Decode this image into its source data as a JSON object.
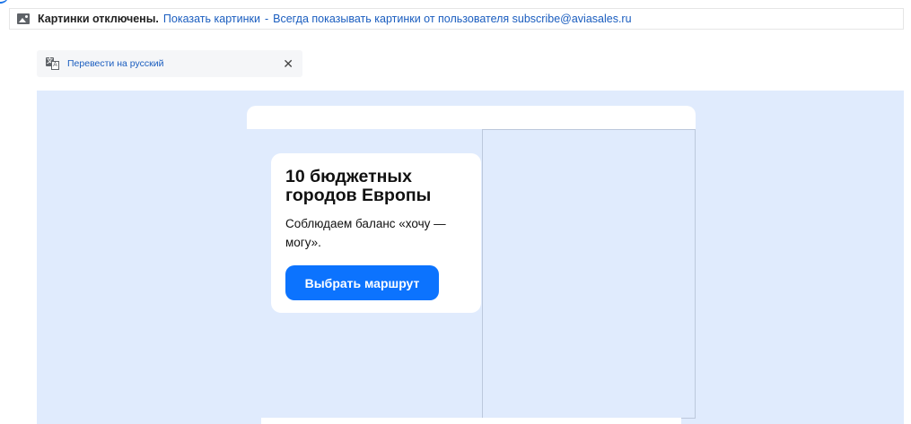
{
  "images_bar": {
    "disabled_text": "Картинки отключены.",
    "show_link": "Показать картинки",
    "separator": "-",
    "always_show_link": "Всегда показывать картинки от пользователя subscribe@aviasales.ru",
    "icon": "image-icon"
  },
  "translate": {
    "icon": "translate-icon",
    "icon_glyph_a": "文",
    "icon_glyph_b": "A",
    "link": "Перевести на русский",
    "close": "✕"
  },
  "email": {
    "card": {
      "title_line1": "10 бюджетных",
      "title_line2": "городов Европы",
      "text": "Соблюдаем баланс «хочу — могу».",
      "button": "Выбрать маршрут"
    }
  },
  "colors": {
    "link": "#1a5dbf",
    "email_background": "#e0ebfd",
    "cta": "#0c73fe"
  }
}
